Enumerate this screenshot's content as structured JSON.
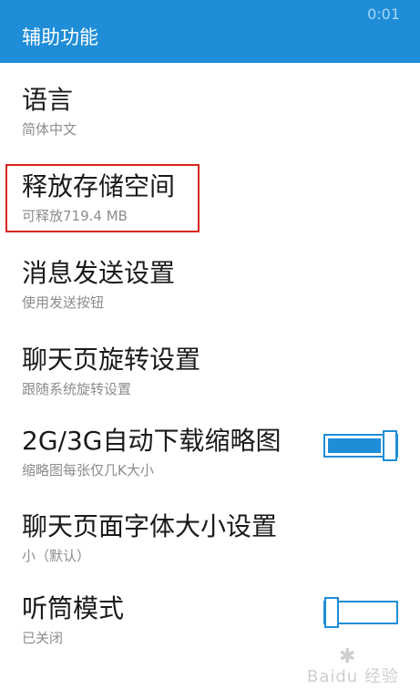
{
  "status_bar": {
    "time": "0:01"
  },
  "header": {
    "title": "辅助功能"
  },
  "settings": [
    {
      "title": "语言",
      "subtitle": "简体中文"
    },
    {
      "title": "释放存储空间",
      "subtitle": "可释放719.4 MB"
    },
    {
      "title": "消息发送设置",
      "subtitle": "使用发送按钮"
    },
    {
      "title": "聊天页旋转设置",
      "subtitle": "跟随系统旋转设置"
    },
    {
      "title": "2G/3G自动下载缩略图",
      "subtitle": "缩略图每张仅几K大小",
      "toggle": "on"
    },
    {
      "title": "聊天页面字体大小设置",
      "subtitle": "小（默认）"
    },
    {
      "title": "听筒模式",
      "subtitle": "已关闭",
      "toggle": "off"
    }
  ],
  "watermark": {
    "text": "Baidu 经验",
    "icon": "baidu-paw-icon"
  },
  "colors": {
    "accent": "#1f8dd7",
    "highlight": "#d9251d",
    "title_text": "#1a1a1a",
    "subtitle_text": "#8c8c8c"
  }
}
